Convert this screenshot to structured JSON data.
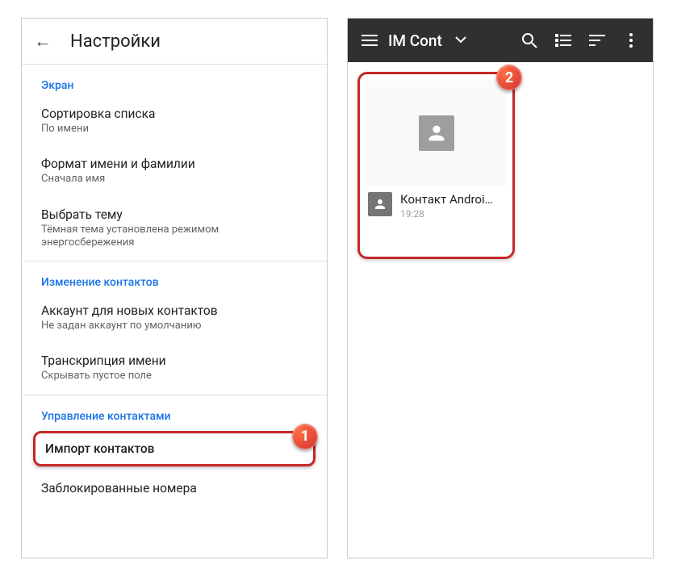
{
  "left": {
    "title": "Настройки",
    "groups": [
      {
        "header": "Экран",
        "items": [
          {
            "title": "Сортировка списка",
            "sub": "По имени"
          },
          {
            "title": "Формат имени и фамилии",
            "sub": "Сначала имя"
          },
          {
            "title": "Выбрать тему",
            "sub": "Тёмная тема установлена режимом энергосбережения"
          }
        ]
      },
      {
        "header": "Изменение контактов",
        "items": [
          {
            "title": "Аккаунт для новых контактов",
            "sub": "Не задан аккаунт по умолчанию"
          },
          {
            "title": "Транскрипция имени",
            "sub": "Скрывать пустое поле"
          }
        ]
      },
      {
        "header": "Управление контактами",
        "items": [
          {
            "title": "Импорт контактов"
          },
          {
            "title": "Заблокированные номера"
          }
        ]
      }
    ],
    "badge1": "1"
  },
  "right": {
    "title": "IM Cont",
    "file": {
      "name": "Контакт Androi…",
      "time": "19:28"
    },
    "badge2": "2"
  }
}
